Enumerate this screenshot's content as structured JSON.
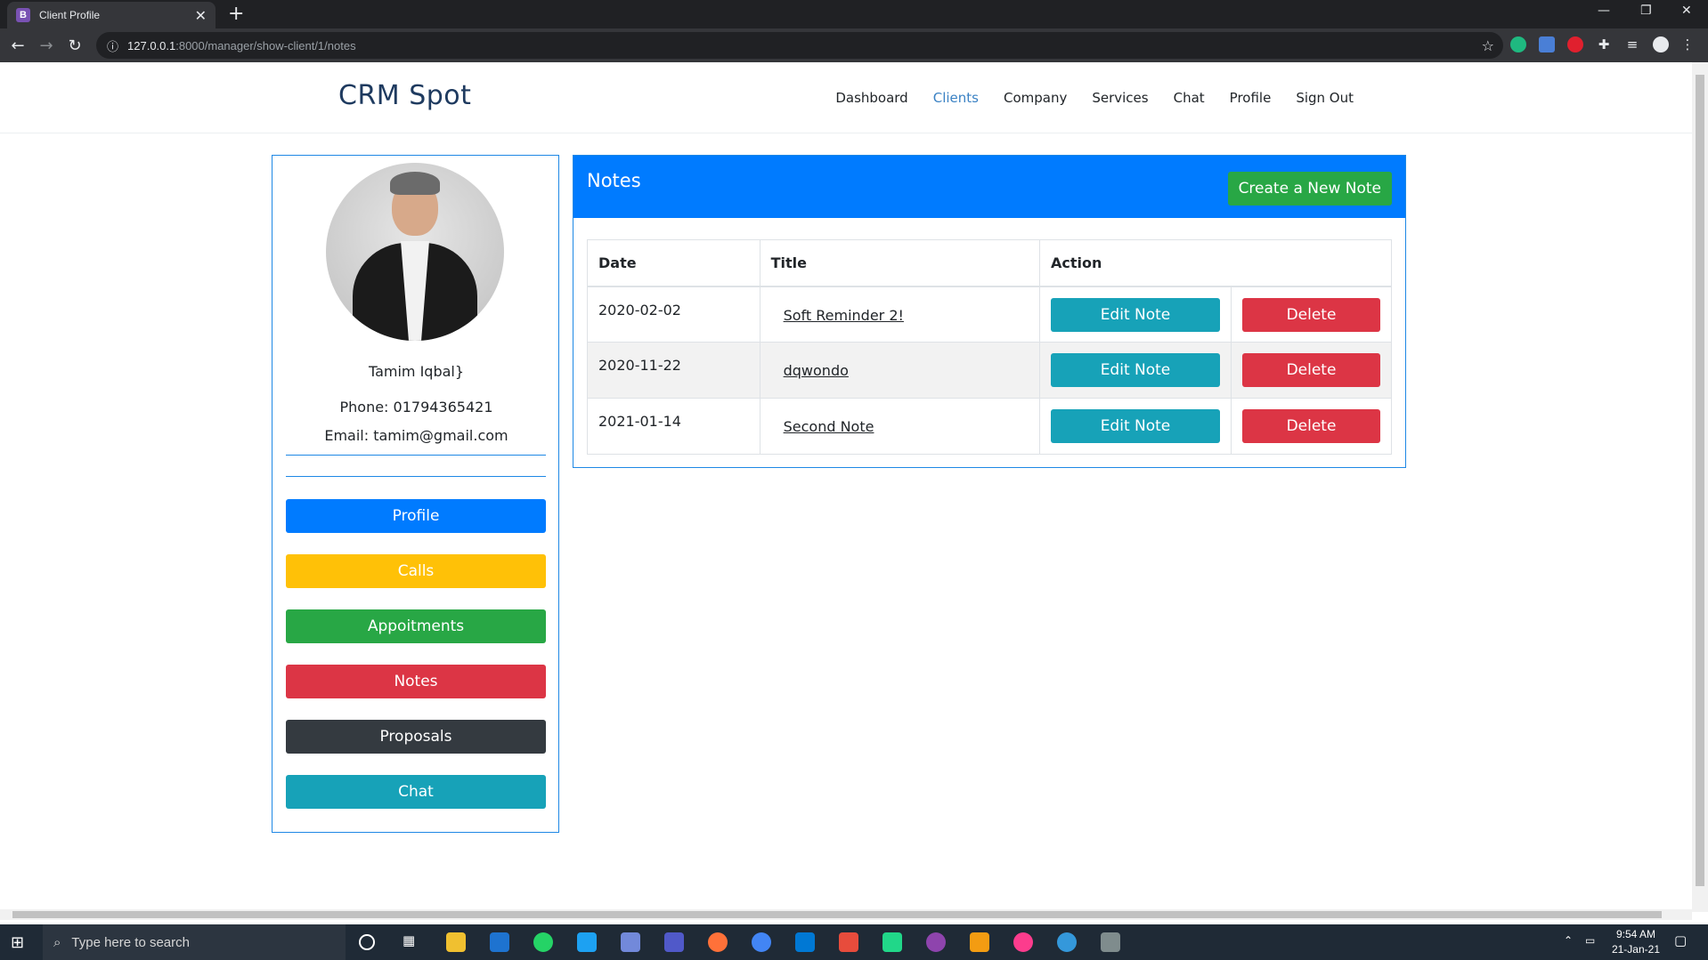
{
  "browser": {
    "tab_title": "Client Profile",
    "tab_favicon": "B",
    "url_host": "127.0.0.1",
    "url_path": ":8000/manager/show-client/1/notes"
  },
  "nav": {
    "brand": "CRM Spot",
    "links": [
      "Dashboard",
      "Clients",
      "Company",
      "Services",
      "Chat",
      "Profile",
      "Sign Out"
    ],
    "active": "Clients"
  },
  "client": {
    "name": "Tamim Iqbal}",
    "phone": "Phone: 01794365421",
    "email": "Email: tamim@gmail.com"
  },
  "sidebar_buttons": [
    {
      "label": "Profile",
      "color": "#007bff"
    },
    {
      "label": "Calls",
      "color": "#ffc107"
    },
    {
      "label": "Appoitments",
      "color": "#28a745"
    },
    {
      "label": "Notes",
      "color": "#dc3545"
    },
    {
      "label": "Proposals",
      "color": "#343a40"
    },
    {
      "label": "Chat",
      "color": "#17a2b8"
    }
  ],
  "notes": {
    "title": "Notes",
    "create_label": "Create a New Note",
    "columns": [
      "Date",
      "Title",
      "Action"
    ],
    "rows": [
      {
        "date": "2020-02-02",
        "title": "Soft Reminder 2!",
        "edit": "Edit Note",
        "delete": "Delete"
      },
      {
        "date": "2020-11-22",
        "title": "dqwondo",
        "edit": "Edit Note",
        "delete": "Delete"
      },
      {
        "date": "2021-01-14",
        "title": "Second Note",
        "edit": "Edit Note",
        "delete": "Delete"
      }
    ]
  },
  "taskbar": {
    "search_placeholder": "Type here to search",
    "time": "9:54 AM",
    "date": "21-Jan-21"
  }
}
